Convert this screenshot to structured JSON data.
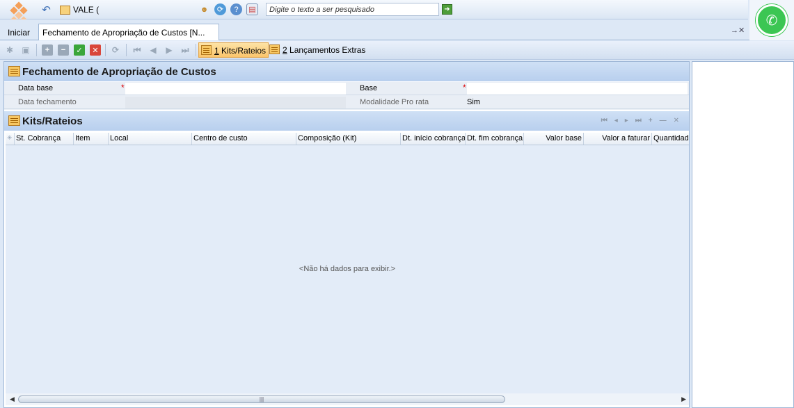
{
  "topbar": {
    "company": "VALE (",
    "search_placeholder": "Digite o texto a ser pesquisado"
  },
  "tabs": {
    "start_label": "Iniciar",
    "active_tab": "Fechamento de Apropriação de Custos [N...",
    "tab_tools": "→✕"
  },
  "toolbar": {
    "tab1_num": "1",
    "tab1_label": " Kits/Rateios",
    "tab2_num": "2",
    "tab2_label": " Lançamentos Extras"
  },
  "form": {
    "title": "Fechamento de Apropriação de Custos",
    "fields": {
      "data_base": "Data base",
      "base": "Base",
      "data_fechamento": "Data fechamento",
      "modalidade": "Modalidade Pro rata",
      "modalidade_value": "Sim"
    }
  },
  "grid": {
    "title": "Kits/Rateios",
    "columns": [
      "St. Cobrança",
      "Item",
      "Local",
      "Centro de custo",
      "Composição (Kit)",
      "Dt. início cobrança",
      "Dt. fim cobrança",
      "Valor base",
      "Valor a faturar",
      "Quantidad"
    ],
    "empty_text": "<Não há dados para exibir.>",
    "tools": [
      "⏮",
      "◂",
      "▸",
      "⏭",
      "+",
      "—",
      "✕"
    ]
  },
  "colors": {
    "accent": "#fbc56c",
    "header": "#b8cfee",
    "whatsapp": "#3cc653"
  }
}
